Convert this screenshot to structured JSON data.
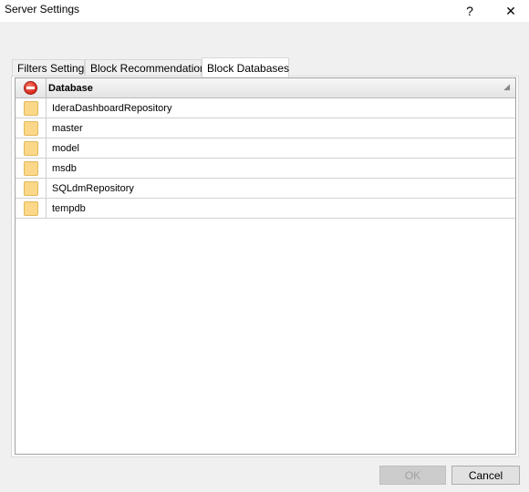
{
  "window": {
    "title": "Server Settings",
    "help_glyph": "?",
    "close_glyph": "✕"
  },
  "tabs": [
    {
      "label": "Filters Settings",
      "active": false
    },
    {
      "label": "Block Recommendations",
      "active": false
    },
    {
      "label": "Block Databases",
      "active": true
    }
  ],
  "grid": {
    "header_icon": "block-icon",
    "column_header": "Database",
    "sort_glyph": "◢",
    "rows": [
      {
        "name": "IderaDashboardRepository"
      },
      {
        "name": "master"
      },
      {
        "name": "model"
      },
      {
        "name": "msdb"
      },
      {
        "name": "SQLdmRepository"
      },
      {
        "name": "tempdb"
      }
    ]
  },
  "buttons": {
    "ok": {
      "label": "OK",
      "enabled": false
    },
    "cancel": {
      "label": "Cancel",
      "enabled": true
    }
  }
}
